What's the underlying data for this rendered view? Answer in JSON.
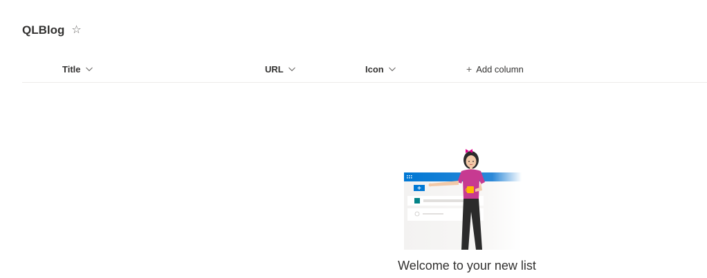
{
  "list": {
    "title": "QLBlog",
    "favorite_icon": "star-outline-icon"
  },
  "columns": [
    {
      "label": "Title",
      "icon": "chevron-down-icon"
    },
    {
      "label": "URL",
      "icon": "chevron-down-icon"
    },
    {
      "label": "Icon",
      "icon": "chevron-down-icon"
    }
  ],
  "add_column": {
    "label": "Add column",
    "icon": "plus-icon"
  },
  "empty_state": {
    "message": "Welcome to your new list",
    "illustration": "woman-with-mug-list-illustration"
  },
  "colors": {
    "accent": "#0078d4",
    "text": "#323130",
    "divider": "#edebe9",
    "teal": "#038387",
    "pink": "#e3008c"
  }
}
